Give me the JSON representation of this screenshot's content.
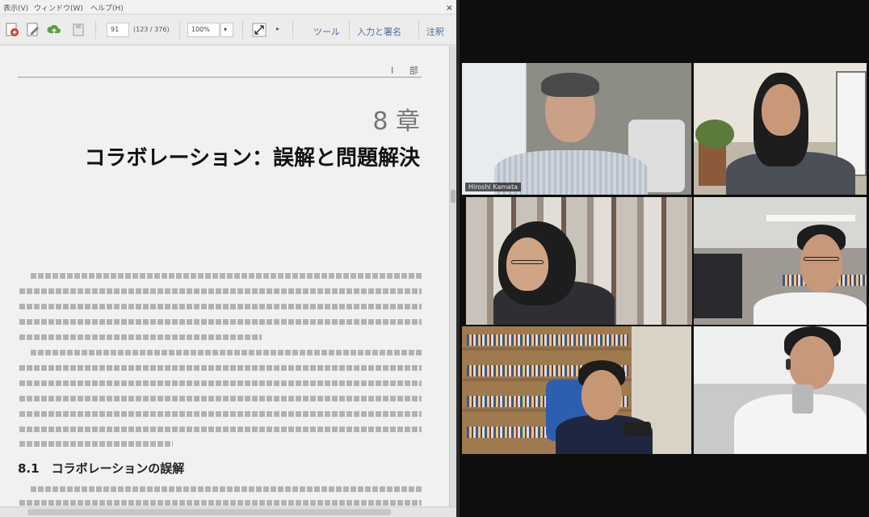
{
  "pdf_viewer": {
    "menu": {
      "items": [
        "表示(V)",
        "ウィンドウ(W)",
        "ヘルプ(H)"
      ],
      "close_glyph": "×"
    },
    "toolbar": {
      "page_number": "91",
      "page_count": "(123 / 376)",
      "zoom": "100%",
      "links": [
        "ツール",
        "入力と署名",
        "注釈"
      ]
    },
    "page": {
      "running_head": "Ⅰ 部",
      "chapter_number": "8 章",
      "chapter_title": "コラボレーション：誤解と問題解決",
      "section_heading": "8.1　コラボレーションの誤解"
    }
  },
  "video_call": {
    "tiles": [
      {
        "id": "host",
        "active": true,
        "name_label": "Hiroshi Kamata"
      },
      {
        "id": "p2",
        "active": false,
        "name_label": ""
      },
      {
        "id": "p3",
        "active": false,
        "name_label": ""
      },
      {
        "id": "p4",
        "active": false,
        "name_label": ""
      },
      {
        "id": "p5",
        "active": false,
        "name_label": ""
      },
      {
        "id": "p6",
        "active": false,
        "name_label": ""
      }
    ],
    "active_speaker_color": "#cfe36a"
  },
  "icons": [
    "pdf-create-icon",
    "edit-icon",
    "cloud-upload-icon",
    "save-icon",
    "fit-icon",
    "dropdown-icon"
  ]
}
